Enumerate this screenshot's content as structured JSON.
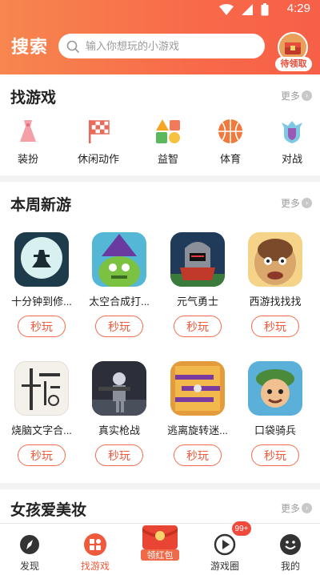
{
  "status": {
    "time": "4:29"
  },
  "header": {
    "title": "搜索",
    "search_placeholder": "输入你想玩的小游戏",
    "reward_label": "待领取"
  },
  "find_games": {
    "title": "找游戏",
    "more": "更多",
    "categories": [
      {
        "label": "装扮",
        "icon": "dress-icon"
      },
      {
        "label": "休闲动作",
        "icon": "flag-icon"
      },
      {
        "label": "益智",
        "icon": "puzzle-shapes-icon"
      },
      {
        "label": "体育",
        "icon": "basketball-icon"
      },
      {
        "label": "对战",
        "icon": "shield-icon"
      }
    ]
  },
  "weekly": {
    "title": "本周新游",
    "more": "更多",
    "play_label": "秒玩",
    "games": [
      {
        "name": "十分钟到修..."
      },
      {
        "name": "太空合成打..."
      },
      {
        "name": "元气勇士"
      },
      {
        "name": "西游找找找"
      },
      {
        "name": "烧脑文字合..."
      },
      {
        "name": "真实枪战"
      },
      {
        "name": "逃离旋转迷..."
      },
      {
        "name": "口袋骑兵"
      }
    ]
  },
  "girls": {
    "title": "女孩爱美妆",
    "more": "更多"
  },
  "tabbar": {
    "tabs": [
      {
        "label": "发现"
      },
      {
        "label": "找游戏"
      },
      {
        "label": "领红包"
      },
      {
        "label": "游戏圈"
      },
      {
        "label": "我的"
      }
    ],
    "badge": "99+"
  },
  "colors": {
    "accent": "#f36d4c",
    "header": "#f7864f"
  }
}
